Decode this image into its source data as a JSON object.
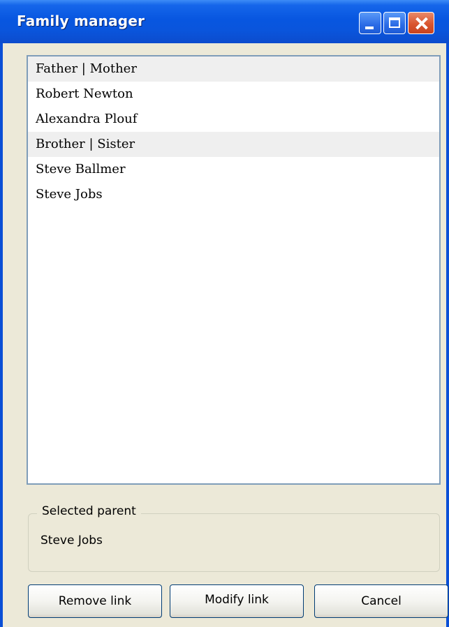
{
  "window": {
    "title": "Family manager"
  },
  "list": {
    "items": [
      {
        "label": "Father | Mother",
        "kind": "header"
      },
      {
        "label": "Robert Newton",
        "kind": "person"
      },
      {
        "label": "Alexandra Plouf",
        "kind": "person"
      },
      {
        "label": "Brother | Sister",
        "kind": "header"
      },
      {
        "label": "Steve Ballmer",
        "kind": "person"
      },
      {
        "label": "Steve Jobs",
        "kind": "person"
      }
    ]
  },
  "selected_parent": {
    "legend": "Selected parent",
    "value": "Steve Jobs"
  },
  "buttons": {
    "remove_label": "Remove link",
    "modify_label": "Modify link",
    "cancel_label": "Cancel"
  },
  "titlebar_icons": [
    "minimize-icon",
    "maximize-icon",
    "close-icon"
  ],
  "colors": {
    "titlebar": "#0a55dc",
    "window_bg": "#ece9d8",
    "list_border": "#7f9db9",
    "header_row_bg": "#efefef"
  }
}
